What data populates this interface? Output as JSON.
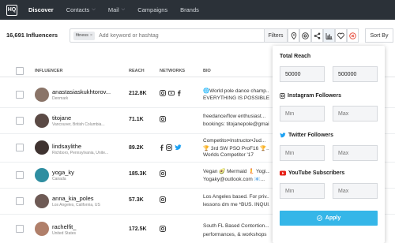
{
  "nav": {
    "logo": "HQ",
    "items": [
      {
        "label": "Discover",
        "active": true,
        "dropdown": false
      },
      {
        "label": "Contacts",
        "active": false,
        "dropdown": true
      },
      {
        "label": "Mail",
        "active": false,
        "dropdown": true
      },
      {
        "label": "Campaigns",
        "active": false,
        "dropdown": false
      },
      {
        "label": "Brands",
        "active": false,
        "dropdown": false
      }
    ]
  },
  "toolbar": {
    "count": "16,691 Influencers",
    "chip": "fitness",
    "search_placeholder": "Add keyword or hashtag",
    "filters_label": "Filters",
    "sort_label": "Sort By"
  },
  "table": {
    "headers": {
      "influencer": "INFLUENCER",
      "reach": "REACH",
      "networks": "NETWORKS",
      "bio": "BIO"
    },
    "rows": [
      {
        "name": "anastasiaskukhtorov...",
        "location": "Denmark",
        "reach": "212.8K",
        "networks": [
          "instagram",
          "youtube",
          "facebook"
        ],
        "bio1": "🌐World pole dance champ...",
        "bio2": "EVERYTHING IS POSSIBLE...",
        "avatar_color": "#8a7468"
      },
      {
        "name": "titojane",
        "location": "Vancouver, British Columbia...",
        "reach": "71.1K",
        "networks": [
          "instagram"
        ],
        "bio1": "freedance/flow enthusiast...",
        "bio2": "bookings: titojanepole@gmail...",
        "avatar_color": "#5b4a45"
      },
      {
        "name": "lindsaylithe",
        "location": "Richboro, Pennsylvania, Unite...",
        "reach": "89.2K",
        "networks": [
          "facebook",
          "instagram",
          "twitter"
        ],
        "bio1": "Competitor•Instructor•Jud...",
        "bio2": "🏆 3rd SW PSO ProF16 🏆...",
        "bio3": "Worlds Competitor '17",
        "avatar_color": "#3f3330"
      },
      {
        "name": "yoga_ky",
        "location": "Canada",
        "reach": "185.3K",
        "networks": [
          "instagram"
        ],
        "bio1": "Vegan 🥑 Mermaid 🧜 Yogi...",
        "bio2": "Yogaky@outlook.com 📧...",
        "avatar_color": "#2f8ea1"
      },
      {
        "name": "anna_kia_poles",
        "location": "Los Angeles, California, US",
        "reach": "57.3K",
        "networks": [
          "instagram"
        ],
        "bio1": "Los Angeles based. For priv...",
        "bio2": "lessons dm me *BUS. INQUI...",
        "avatar_color": "#6e5a55"
      },
      {
        "name": "rachelfit_",
        "location": "United States",
        "reach": "172.5K",
        "networks": [
          "instagram"
        ],
        "bio1": "South FL Based Contortion...",
        "bio2": "performances, & workshops",
        "avatar_color": "#b07f6a"
      }
    ]
  },
  "panel": {
    "total_reach_label": "Total Reach",
    "total_reach_min": "50000",
    "total_reach_max": "500000",
    "instagram_label": "Instagram Followers",
    "twitter_label": "Twitter Followers",
    "youtube_label": "YouTube Subscribers",
    "min_placeholder": "Min",
    "max_placeholder": "Max",
    "apply_label": "Apply"
  },
  "colors": {
    "nav_bg": "#2b3138",
    "apply": "#35b6e8",
    "instagram": "#333333",
    "twitter": "#1da1f2",
    "youtube": "#e62117",
    "facebook": "#3b5998",
    "remove": "#e74c3c"
  }
}
